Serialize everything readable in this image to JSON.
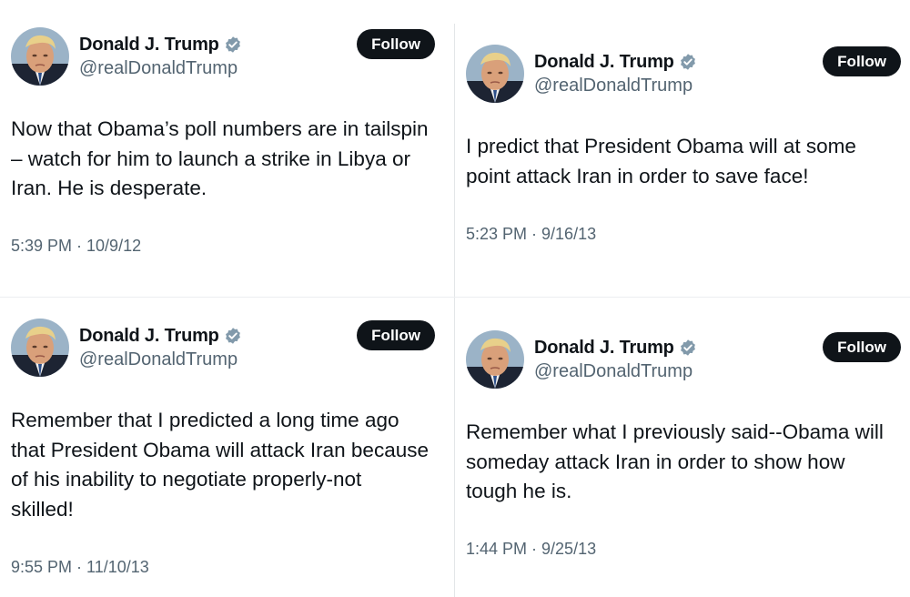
{
  "tweets": [
    {
      "display_name": "Donald J. Trump",
      "handle": "@realDonaldTrump",
      "follow_label": "Follow",
      "text": "Now that Obama’s poll numbers are in tailspin – watch for him to launch a strike in Libya or Iran.  He is desperate.",
      "time": "5:39 PM · 10/9/12"
    },
    {
      "display_name": "Donald J. Trump",
      "handle": "@realDonaldTrump",
      "follow_label": "Follow",
      "text": "I predict that President Obama will at some point attack Iran in order to save face!",
      "time": "5:23 PM · 9/16/13"
    },
    {
      "display_name": "Donald J. Trump",
      "handle": "@realDonaldTrump",
      "follow_label": "Follow",
      "text": "Remember that I predicted a long time ago that President Obama will attack Iran because of his inability to negotiate properly-not skilled!",
      "time": "9:55 PM · 11/10/13"
    },
    {
      "display_name": "Donald J. Trump",
      "handle": "@realDonaldTrump",
      "follow_label": "Follow",
      "text": "Remember what I previously said--Obama will someday attack Iran in order to show how tough he is.",
      "time": "1:44 PM · 9/25/13"
    }
  ],
  "colors": {
    "text_primary": "#0f1419",
    "text_secondary": "#536471",
    "verified_badge": "#829aab",
    "follow_button_bg": "#0f1419",
    "follow_button_text": "#ffffff"
  },
  "icons": {
    "verified": "verified-badge-icon",
    "avatar": "profile-photo"
  }
}
